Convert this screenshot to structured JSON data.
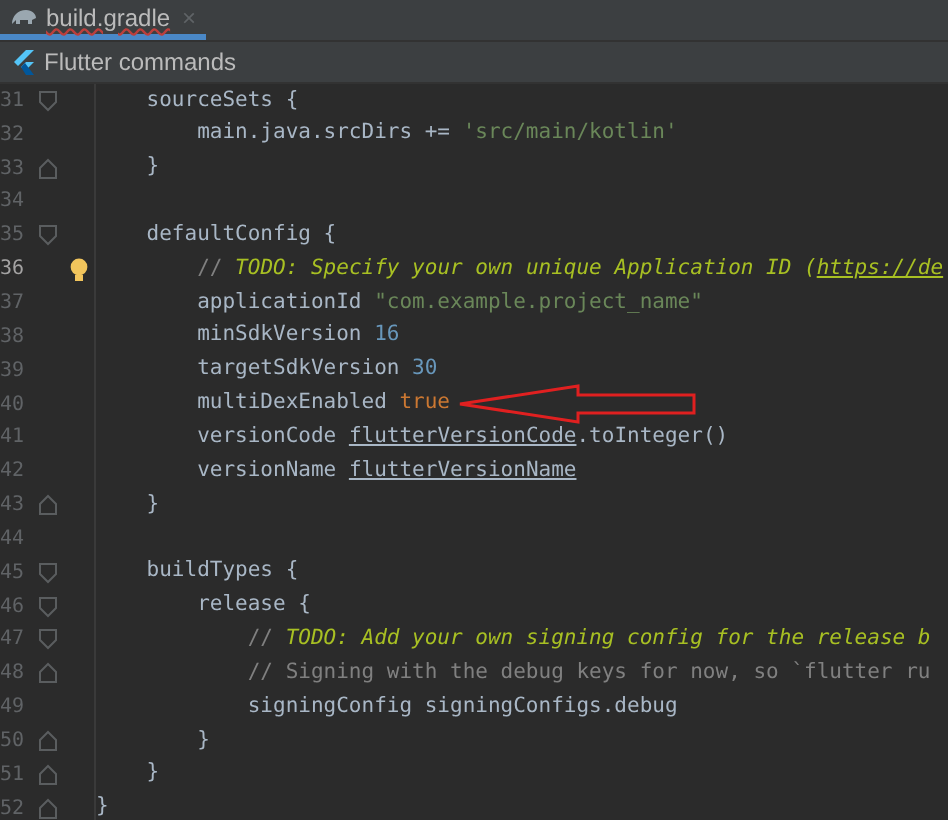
{
  "tabs": [
    {
      "label": "build.gradle",
      "selected": true,
      "has_error": true,
      "close": "×"
    }
  ],
  "toolbar": {
    "label": "Flutter commands"
  },
  "lines": [
    {
      "number": "31",
      "current": false,
      "fold_start": true,
      "fold_end": false,
      "segments": [
        {
          "kind": "plain",
          "text": "    sourceSets {"
        }
      ]
    },
    {
      "number": "32",
      "current": false,
      "fold_start": false,
      "fold_end": false,
      "segments": [
        {
          "kind": "plain",
          "text": "        main.java.srcDirs += "
        },
        {
          "kind": "string",
          "text": "'src/main/kotlin'"
        }
      ]
    },
    {
      "number": "33",
      "current": false,
      "fold_start": false,
      "fold_end": true,
      "segments": [
        {
          "kind": "plain",
          "text": "    }"
        }
      ]
    },
    {
      "number": "34",
      "current": false,
      "fold_start": false,
      "fold_end": false
    },
    {
      "number": "35",
      "current": false,
      "fold_start": true,
      "fold_end": false,
      "segments": [
        {
          "kind": "plain",
          "text": "    defaultConfig {"
        }
      ]
    },
    {
      "number": "36",
      "current": true,
      "fold_start": false,
      "fold_end": false,
      "bulb": true,
      "segments": [
        {
          "kind": "comment",
          "text": "        // "
        },
        {
          "kind": "todo",
          "text": "TODO: Specify your own unique Application ID ("
        },
        {
          "kind": "todo-link",
          "text": "https://de"
        }
      ]
    },
    {
      "number": "37",
      "current": false,
      "fold_start": false,
      "fold_end": false,
      "segments": [
        {
          "kind": "plain",
          "text": "        applicationId "
        },
        {
          "kind": "string",
          "text": "\"com.example.project_name\""
        }
      ]
    },
    {
      "number": "38",
      "current": false,
      "fold_start": false,
      "fold_end": false,
      "segments": [
        {
          "kind": "plain",
          "text": "        minSdkVersion "
        },
        {
          "kind": "number",
          "text": "16"
        }
      ]
    },
    {
      "number": "39",
      "current": false,
      "fold_start": false,
      "fold_end": false,
      "segments": [
        {
          "kind": "plain",
          "text": "        targetSdkVersion "
        },
        {
          "kind": "number",
          "text": "30"
        }
      ]
    },
    {
      "number": "40",
      "current": false,
      "fold_start": false,
      "fold_end": false,
      "arrow": true,
      "segments": [
        {
          "kind": "plain",
          "text": "        multiDexEnabled "
        },
        {
          "kind": "keyword",
          "text": "true"
        }
      ]
    },
    {
      "number": "41",
      "current": false,
      "fold_start": false,
      "fold_end": false,
      "segments": [
        {
          "kind": "plain",
          "text": "        versionCode "
        },
        {
          "kind": "link",
          "text": "flutterVersionCode"
        },
        {
          "kind": "plain",
          "text": ".toInteger()"
        }
      ]
    },
    {
      "number": "42",
      "current": false,
      "fold_start": false,
      "fold_end": false,
      "segments": [
        {
          "kind": "plain",
          "text": "        versionName "
        },
        {
          "kind": "link",
          "text": "flutterVersionName"
        }
      ]
    },
    {
      "number": "43",
      "current": false,
      "fold_start": false,
      "fold_end": true,
      "segments": [
        {
          "kind": "plain",
          "text": "    }"
        }
      ]
    },
    {
      "number": "44",
      "current": false,
      "fold_start": false,
      "fold_end": false
    },
    {
      "number": "45",
      "current": false,
      "fold_start": true,
      "fold_end": false,
      "segments": [
        {
          "kind": "plain",
          "text": "    buildTypes {"
        }
      ]
    },
    {
      "number": "46",
      "current": false,
      "fold_start": true,
      "fold_end": false,
      "segments": [
        {
          "kind": "plain",
          "text": "        release {"
        }
      ]
    },
    {
      "number": "47",
      "current": false,
      "fold_start": true,
      "fold_end": false,
      "segments": [
        {
          "kind": "comment",
          "text": "            // "
        },
        {
          "kind": "todo",
          "text": "TODO: Add your own signing config for the release b"
        }
      ]
    },
    {
      "number": "48",
      "current": false,
      "fold_start": false,
      "fold_end": true,
      "segments": [
        {
          "kind": "comment",
          "text": "            // Signing with the debug keys for now, so `flutter ru"
        }
      ]
    },
    {
      "number": "49",
      "current": false,
      "fold_start": false,
      "fold_end": false,
      "segments": [
        {
          "kind": "plain",
          "text": "            signingConfig signingConfigs.debug"
        }
      ]
    },
    {
      "number": "50",
      "current": false,
      "fold_start": false,
      "fold_end": true,
      "segments": [
        {
          "kind": "plain",
          "text": "        }"
        }
      ]
    },
    {
      "number": "51",
      "current": false,
      "fold_start": false,
      "fold_end": true,
      "segments": [
        {
          "kind": "plain",
          "text": "    }"
        }
      ]
    },
    {
      "number": "52",
      "current": false,
      "fold_start": false,
      "fold_end": true,
      "segments": [
        {
          "kind": "plain",
          "text": "}"
        }
      ]
    }
  ]
}
